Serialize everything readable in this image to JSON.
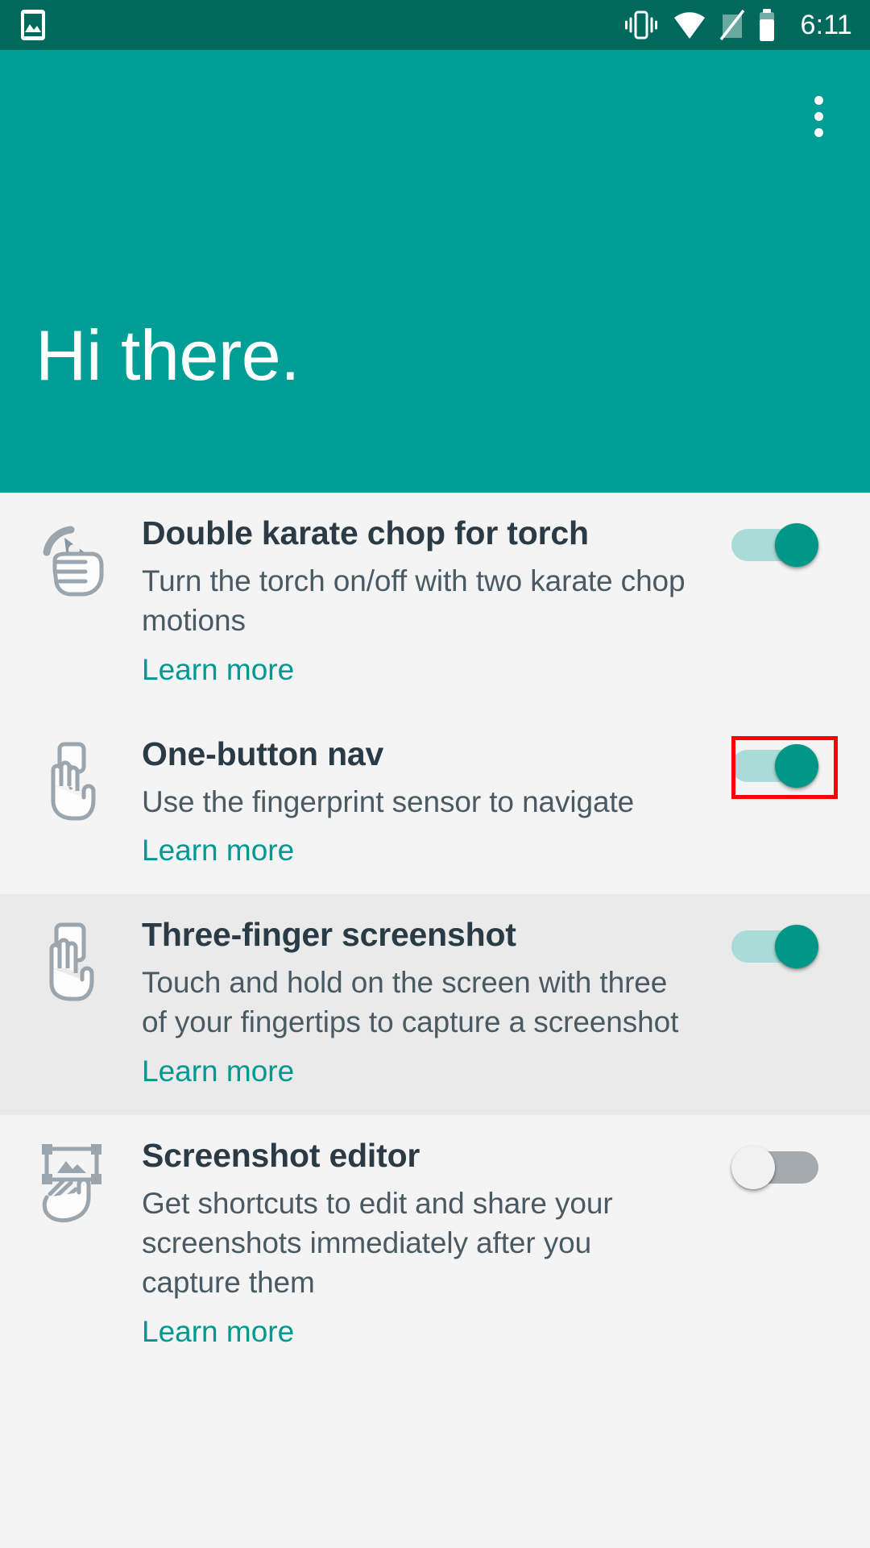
{
  "status_bar": {
    "notification_icon": "image-icon",
    "icons": [
      "vibrate-icon",
      "wifi-icon",
      "sim-card-off-icon",
      "battery-icon"
    ],
    "time": "6:11",
    "background_color": "#00695C"
  },
  "header": {
    "greeting": "Hi there.",
    "overflow_menu_label": "More options",
    "background_color": "#009E94"
  },
  "theme": {
    "accent": "#009688",
    "link": "#00998F",
    "row_bg": "#F4F4F4",
    "row_bg_alt": "#EAEAEA",
    "title_color": "#2B3B45",
    "highlight_color": "#FF0000"
  },
  "list": {
    "items": [
      {
        "icon": "karate-chop-hand-icon",
        "title": "Double karate chop for torch",
        "description": "Turn the torch on/off with two karate chop motions",
        "link": "Learn more",
        "toggle_state": "on",
        "highlighted_row": false,
        "toggle_highlighted": false
      },
      {
        "icon": "fingerprint-tap-hand-icon",
        "title": "One-button nav",
        "description": "Use the fingerprint sensor to navigate",
        "link": "Learn more",
        "toggle_state": "on",
        "highlighted_row": false,
        "toggle_highlighted": true
      },
      {
        "icon": "three-finger-hand-icon",
        "title": "Three-finger screenshot",
        "description": "Touch and hold on the screen with three of your fingertips to capture a screenshot",
        "link": "Learn more",
        "toggle_state": "on",
        "highlighted_row": true,
        "toggle_highlighted": false
      },
      {
        "icon": "screenshot-editor-hand-icon",
        "title": "Screenshot editor",
        "description": "Get shortcuts to edit and share your screenshots immediately after you capture them",
        "link": "Learn more",
        "toggle_state": "off",
        "highlighted_row": false,
        "toggle_highlighted": false
      }
    ]
  }
}
